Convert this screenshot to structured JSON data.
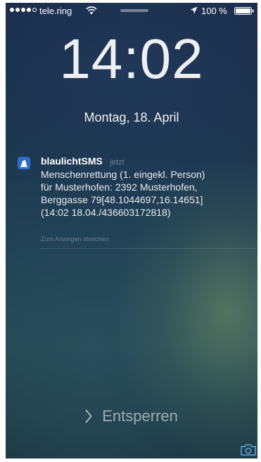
{
  "status_bar": {
    "signal_dots_filled": 4,
    "signal_dots_total": 5,
    "carrier": "tele.ring",
    "battery_percent": "100 %",
    "icons": [
      "wifi-icon",
      "location-arrow-icon",
      "battery-icon"
    ]
  },
  "lock_screen": {
    "time": "14:02",
    "date": "Montag, 18. April"
  },
  "notification": {
    "app_icon": "blaulichtsms-app-icon",
    "app_name": "blaulichtSMS",
    "time": "jetzt",
    "body_lines": [
      "Menschenrettung (1. eingekl. Person)",
      "für Musterhofen: 2392 Musterhofen,",
      "Berggasse 79[48.1044697,16.14651]",
      "(14:02 18.04./436603172818)"
    ],
    "action_hint": "Zum Anzeigen streichen"
  },
  "unlock": {
    "label": "Entsperren",
    "icon": "chevron-right-icon"
  },
  "camera": {
    "icon": "camera-icon"
  },
  "colors": {
    "app_icon_bg": "#2f6cc9",
    "wallpaper_top": "#1b2d4c",
    "wallpaper_bottom": "#264c57"
  }
}
